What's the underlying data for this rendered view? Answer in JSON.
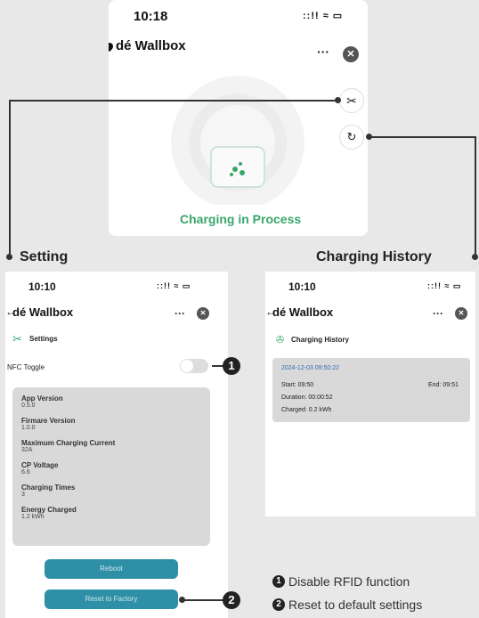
{
  "top_phone": {
    "time": "10:18",
    "app_title": "dé Wallbox",
    "menu_glyph": "···",
    "status_text": "Charging in Process"
  },
  "left_phone": {
    "time": "10:10",
    "app_title": "dé Wallbox",
    "menu_glyph": "···",
    "section_title": "Settings",
    "nfc_label": "NFC Toggle",
    "info": [
      {
        "label": "App Version",
        "value": "0.5.0"
      },
      {
        "label": "Firmare Version",
        "value": "1.0.0"
      },
      {
        "label": "Maximum Charging Current",
        "value": "32A"
      },
      {
        "label": "CP Voltage",
        "value": "6.6"
      },
      {
        "label": "Charging Times",
        "value": "3"
      },
      {
        "label": "Energy Charged",
        "value": "1.2 kWh"
      }
    ],
    "reboot_label": "Reboot",
    "reset_label": "Reset to Factory"
  },
  "right_phone": {
    "time": "10:10",
    "app_title": "dé Wallbox",
    "menu_glyph": "···",
    "section_title": "Charging History",
    "record": {
      "datetime": "2024-12-03 09:50:22",
      "start": "Start: 09:50",
      "end": "End: 09:51",
      "duration": "Duration: 00:00:52",
      "charged": "Charged: 0.2 kWh"
    }
  },
  "labels": {
    "setting": "Setting",
    "charging_history": "Charging History",
    "badge1": "1",
    "badge2": "2"
  },
  "legend": [
    {
      "num": "1",
      "text": "Disable RFID function"
    },
    {
      "num": "2",
      "text": "Reset to default settings"
    }
  ],
  "colors": {
    "accent_green": "#3aa66a",
    "button_teal": "#2f8fa6",
    "card_gray": "#d9d9d9"
  }
}
